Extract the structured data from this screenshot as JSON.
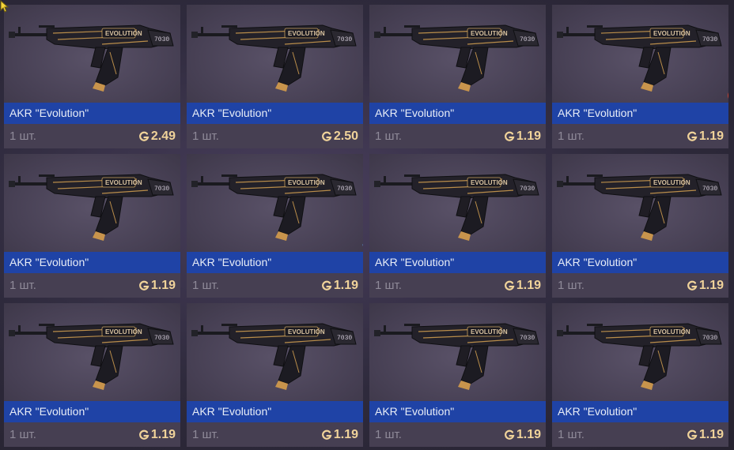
{
  "items": [
    {
      "name": "AKR \"Evolution\"",
      "qty": "1 шт.",
      "price": "2.49",
      "sticker": "butterfly-sticker-icon"
    },
    {
      "name": "AKR \"Evolution\"",
      "qty": "1 шт.",
      "price": "2.50",
      "sticker": "butterfly-sticker-icon"
    },
    {
      "name": "AKR \"Evolution\"",
      "qty": "1 шт.",
      "price": "1.19",
      "sticker": "flower-sticker-icon"
    },
    {
      "name": "AKR \"Evolution\"",
      "qty": "1 шт.",
      "price": "1.19",
      "sticker": "skull-sticker-icon"
    },
    {
      "name": "AKR \"Evolution\"",
      "qty": "1 шт.",
      "price": "1.19",
      "sticker": "flower-sticker-icon"
    },
    {
      "name": "AKR \"Evolution\"",
      "qty": "1 шт.",
      "price": "1.19",
      "sticker": "wreath-sticker-icon"
    },
    {
      "name": "AKR \"Evolution\"",
      "qty": "1 шт.",
      "price": "1.19",
      "sticker": "flower-sticker-icon"
    },
    {
      "name": "AKR \"Evolution\"",
      "qty": "1 шт.",
      "price": "1.19",
      "sticker": "flower-sticker-icon"
    },
    {
      "name": "AKR \"Evolution\"",
      "qty": "1 шт.",
      "price": "1.19",
      "sticker": "flower-sticker-icon"
    },
    {
      "name": "AKR \"Evolution\"",
      "qty": "1 шт.",
      "price": "1.19",
      "sticker": "flower-sticker-icon"
    },
    {
      "name": "AKR \"Evolution\"",
      "qty": "1 шт.",
      "price": "1.19",
      "sticker": "butterfly-sticker-icon"
    },
    {
      "name": "AKR \"Evolution\"",
      "qty": "1 шт.",
      "price": "1.19",
      "sticker": "flower-sticker-icon"
    }
  ],
  "colors": {
    "name_bar": "#1f43a6",
    "price": "#f0d39a",
    "qty": "#8f8a99"
  }
}
